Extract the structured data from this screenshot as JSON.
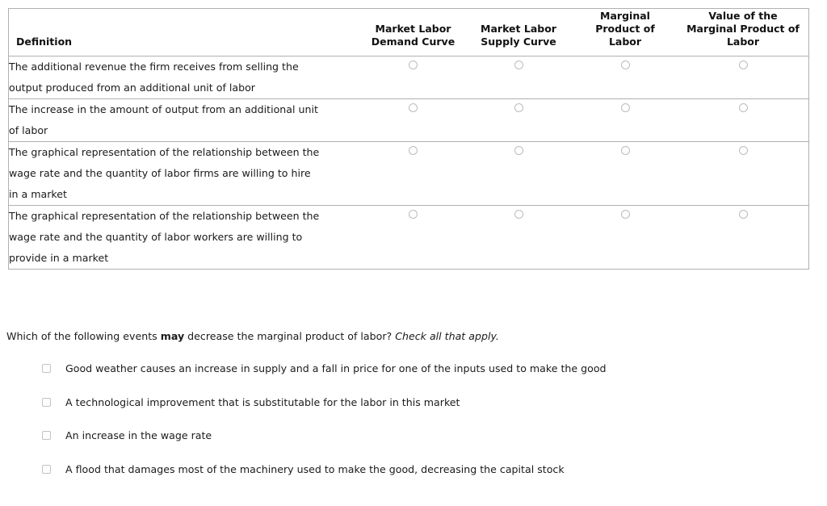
{
  "matching_table": {
    "headers": [
      "Definition",
      "Market Labor Demand Curve",
      "Market Labor Supply Curve",
      "Marginal Product of Labor",
      "Value of the Marginal Product of Labor"
    ],
    "headers_lines": [
      [
        "Definition"
      ],
      [
        "Market Labor",
        "Demand Curve"
      ],
      [
        "Market Labor",
        "Supply Curve"
      ],
      [
        "Marginal",
        "Product of",
        "Labor"
      ],
      [
        "Value of the",
        "Marginal Product of",
        "Labor"
      ]
    ],
    "rows": [
      {
        "definition": "The additional revenue the firm receives from selling the output produced from an additional unit of labor",
        "definition_lines": [
          "The additional revenue the firm receives from selling the",
          "output produced from an additional unit of labor"
        ],
        "selected": null
      },
      {
        "definition": "The increase in the amount of output from an additional unit of labor",
        "definition_lines": [
          "The increase in the amount of output from an additional unit",
          "of labor"
        ],
        "selected": null
      },
      {
        "definition": "The graphical representation of the relationship between the wage rate and the quantity of labor firms are willing to hire in a market",
        "definition_lines": [
          "The graphical representation of the relationship between the",
          "wage rate and the quantity of labor firms are willing to hire",
          "in a market"
        ],
        "selected": null
      },
      {
        "definition": "The graphical representation of the relationship between the wage rate and the quantity of labor workers are willing to provide in a market",
        "definition_lines": [
          "The graphical representation of the relationship between the",
          "wage rate and the quantity of labor workers are willing to",
          "provide in a market"
        ],
        "selected": null
      }
    ]
  },
  "question": {
    "text_before": "Which of the following events ",
    "emphasis": "may",
    "text_middle": " decrease the marginal product of labor? ",
    "instruction": "Check all that apply."
  },
  "choices": [
    {
      "label": "Good weather causes an increase in supply and a fall in price for one of the inputs used to make the good",
      "checked": false
    },
    {
      "label": "A technological improvement that is substitutable for the labor in this market",
      "checked": false
    },
    {
      "label": "An increase in the wage rate",
      "checked": false
    },
    {
      "label": "A flood that damages most of the machinery used to make the good, decreasing the capital stock",
      "checked": false
    }
  ],
  "colors": {
    "border": "#b0b0b0",
    "text": "#1a1a1a",
    "control_border": "#bcbcbc",
    "background": "#ffffff"
  }
}
